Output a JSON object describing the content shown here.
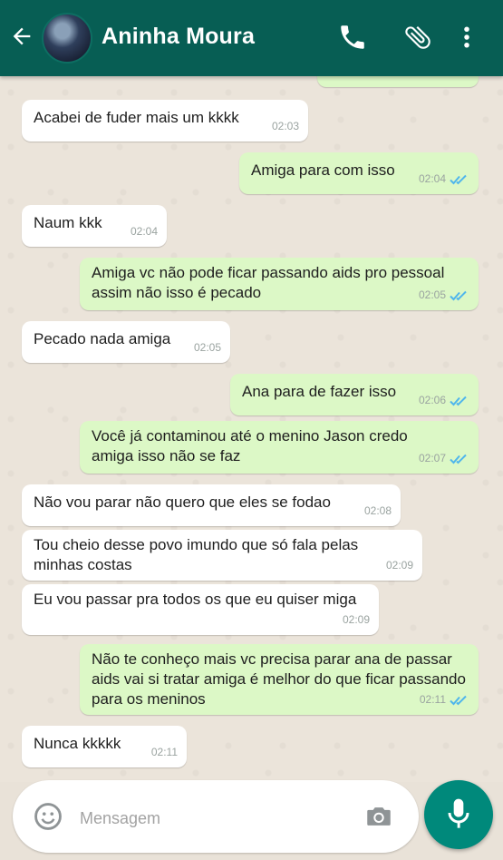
{
  "header": {
    "contact_name": "Aninha Moura",
    "icons": [
      "back-arrow-icon",
      "avatar",
      "phone-icon",
      "paperclip-icon",
      "more-vert-icon"
    ],
    "bg_color": "#075e54"
  },
  "messages": [
    {
      "dir": "in",
      "text": "Acabei de fuder mais um kkkk",
      "time": "02:03"
    },
    {
      "dir": "out",
      "text": "Amiga para com isso",
      "time": "02:04",
      "status": "read"
    },
    {
      "dir": "in",
      "text": "Naum kkk",
      "time": "02:04"
    },
    {
      "dir": "out",
      "text": "Amiga vc não pode ficar passando aids pro pessoal assim não isso é pecado",
      "time": "02:05",
      "status": "read"
    },
    {
      "dir": "in",
      "text": "Pecado nada amiga",
      "time": "02:05"
    },
    {
      "dir": "out",
      "text": "Ana para de fazer isso",
      "time": "02:06",
      "status": "read"
    },
    {
      "dir": "out",
      "text": "Você já contaminou até o menino Jason credo amiga isso não se faz",
      "time": "02:07",
      "status": "read"
    },
    {
      "dir": "in",
      "text": "Não vou parar não quero que eles se fodao",
      "time": "02:08"
    },
    {
      "dir": "in",
      "text": "Tou cheio desse povo imundo que só fala pelas minhas costas",
      "time": "02:09"
    },
    {
      "dir": "in",
      "text": "Eu vou passar pra todos os que eu quiser miga",
      "time": "02:09"
    },
    {
      "dir": "out",
      "text": "Não te conheço mais vc precisa parar ana de passar aids vai si tratar amiga é melhor do que ficar passando para os meninos",
      "time": "02:11",
      "status": "read"
    },
    {
      "dir": "in",
      "text": "Nunca kkkkk",
      "time": "02:11"
    }
  ],
  "composer": {
    "placeholder": "Mensagem",
    "icons": [
      "emoji-icon",
      "camera-icon",
      "mic-icon"
    ]
  },
  "colors": {
    "incoming": "#ffffff",
    "outgoing": "#dcf8c6",
    "tick_read": "#4fb6ec",
    "fab": "#00897b"
  }
}
